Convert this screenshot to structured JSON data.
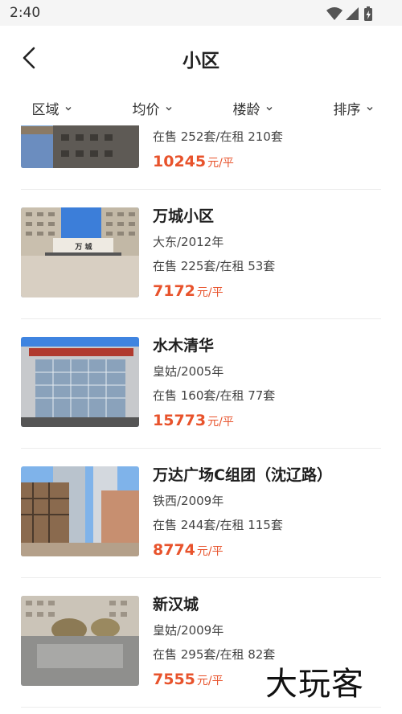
{
  "status_bar": {
    "time": "2:40"
  },
  "header": {
    "title": "小区"
  },
  "filters": [
    {
      "label": "区域"
    },
    {
      "label": "均价"
    },
    {
      "label": "楼龄"
    },
    {
      "label": "排序"
    }
  ],
  "listings": [
    {
      "name": "",
      "district_year": "",
      "stock": "在售 252套/在租 210套",
      "price": "10245",
      "unit": "元/平"
    },
    {
      "name": "万城小区",
      "district_year": "大东/2012年",
      "stock": "在售 225套/在租 53套",
      "price": "7172",
      "unit": "元/平",
      "sign": "万 城"
    },
    {
      "name": "水木清华",
      "district_year": "皇姑/2005年",
      "stock": "在售 160套/在租 77套",
      "price": "15773",
      "unit": "元/平"
    },
    {
      "name": "万达广场C组团（沈辽路）",
      "district_year": "铁西/2009年",
      "stock": "在售 244套/在租 115套",
      "price": "8774",
      "unit": "元/平"
    },
    {
      "name": "新汉城",
      "district_year": "皇姑/2009年",
      "stock": "在售 295套/在租 82套",
      "price": "7555",
      "unit": "元/平"
    }
  ],
  "watermark": "大玩客",
  "colors": {
    "price": "#e8532c",
    "title": "#222222",
    "divider": "#ececec",
    "status_bg": "#f5f5f5"
  }
}
